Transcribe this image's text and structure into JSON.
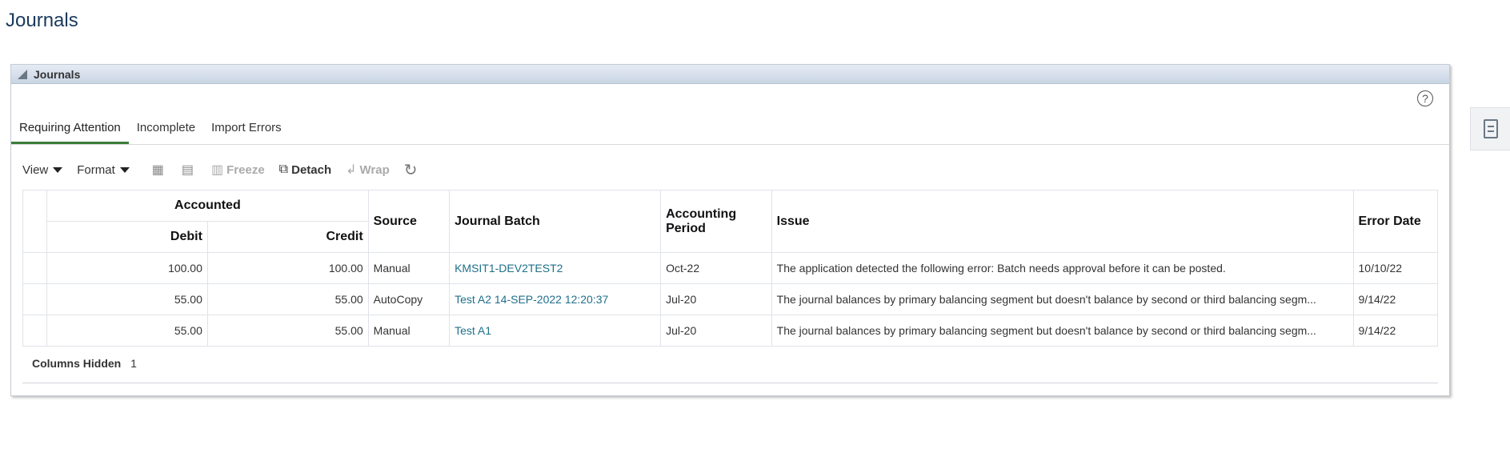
{
  "page": {
    "title": "Journals"
  },
  "panel": {
    "title": "Journals",
    "tabs": [
      {
        "label": "Requiring Attention",
        "active": true
      },
      {
        "label": "Incomplete",
        "active": false
      },
      {
        "label": "Import Errors",
        "active": false
      }
    ]
  },
  "toolbar": {
    "view_label": "View",
    "format_label": "Format",
    "freeze_label": "Freeze",
    "detach_label": "Detach",
    "wrap_label": "Wrap"
  },
  "table": {
    "group_header": "Accounted",
    "columns": {
      "debit": "Debit",
      "credit": "Credit",
      "source": "Source",
      "journal_batch": "Journal Batch",
      "accounting_period": "Accounting Period",
      "issue": "Issue",
      "error_date": "Error Date"
    },
    "rows": [
      {
        "debit": "100.00",
        "credit": "100.00",
        "source": "Manual",
        "journal_batch": "KMSIT1-DEV2TEST2",
        "accounting_period": "Oct-22",
        "issue": "The application detected the following error: Batch needs approval before it can be posted.",
        "error_date": "10/10/22"
      },
      {
        "debit": "55.00",
        "credit": "55.00",
        "source": "AutoCopy",
        "journal_batch": "Test A2 14-SEP-2022 12:20:37",
        "accounting_period": "Jul-20",
        "issue": "The journal balances by primary balancing segment but doesn't balance by second or third balancing segm...",
        "error_date": "9/14/22"
      },
      {
        "debit": "55.00",
        "credit": "55.00",
        "source": "Manual",
        "journal_batch": "Test A1",
        "accounting_period": "Jul-20",
        "issue": "The journal balances by primary balancing segment but doesn't balance by second or third balancing segm...",
        "error_date": "9/14/22"
      }
    ]
  },
  "footer": {
    "columns_hidden_label": "Columns Hidden",
    "columns_hidden_count": "1"
  },
  "colors": {
    "link": "#1f6f8b",
    "active_tab": "#3b7d3b",
    "title": "#1b3a5c"
  }
}
